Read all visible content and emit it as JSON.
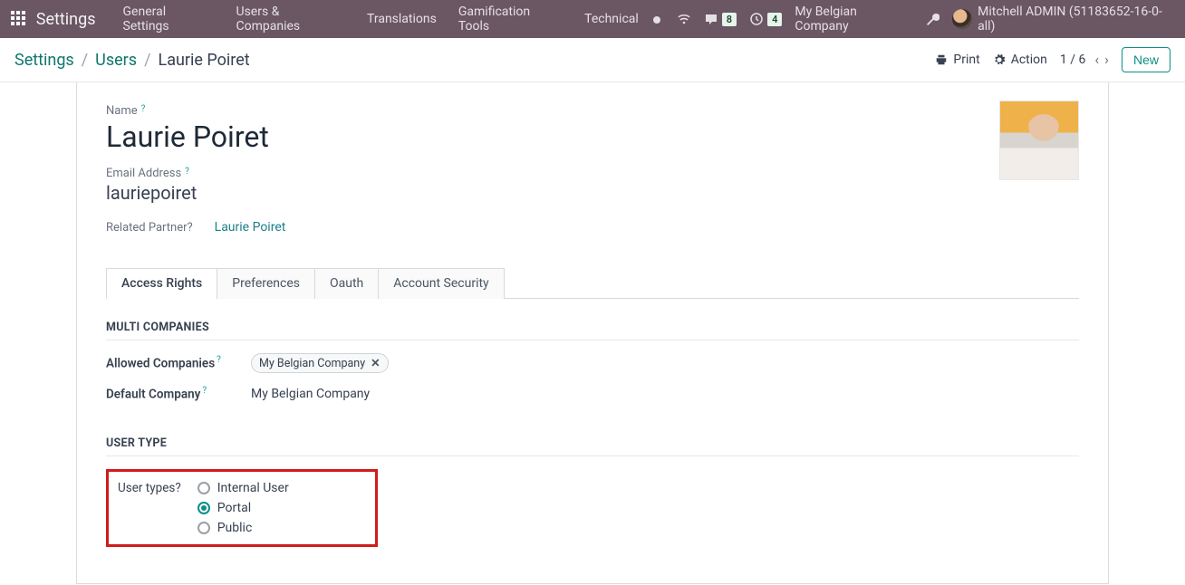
{
  "topbar": {
    "brand": "Settings",
    "menu": [
      "General Settings",
      "Users & Companies",
      "Translations",
      "Gamification Tools",
      "Technical"
    ],
    "messages_badge": "8",
    "activities_badge": "4",
    "company": "My Belgian Company",
    "user": "Mitchell ADMIN (51183652-16-0-all)"
  },
  "controlbar": {
    "breadcrumb": [
      "Settings",
      "Users",
      "Laurie Poiret"
    ],
    "print": "Print",
    "action": "Action",
    "pager": "1 / 6",
    "new": "New"
  },
  "form": {
    "name_label": "Name",
    "name_value": "Laurie Poiret",
    "email_label": "Email Address",
    "email_value": "lauriepoiret",
    "related_partner_label": "Related Partner",
    "related_partner_value": "Laurie Poiret",
    "tabs": [
      "Access Rights",
      "Preferences",
      "Oauth",
      "Account Security"
    ]
  },
  "multi_companies": {
    "title": "MULTI COMPANIES",
    "allowed_label": "Allowed Companies",
    "allowed_tag": "My Belgian Company",
    "default_label": "Default Company",
    "default_value": "My Belgian Company"
  },
  "user_type": {
    "title": "USER TYPE",
    "label": "User types",
    "options": [
      "Internal User",
      "Portal",
      "Public"
    ],
    "selected": "Portal"
  }
}
